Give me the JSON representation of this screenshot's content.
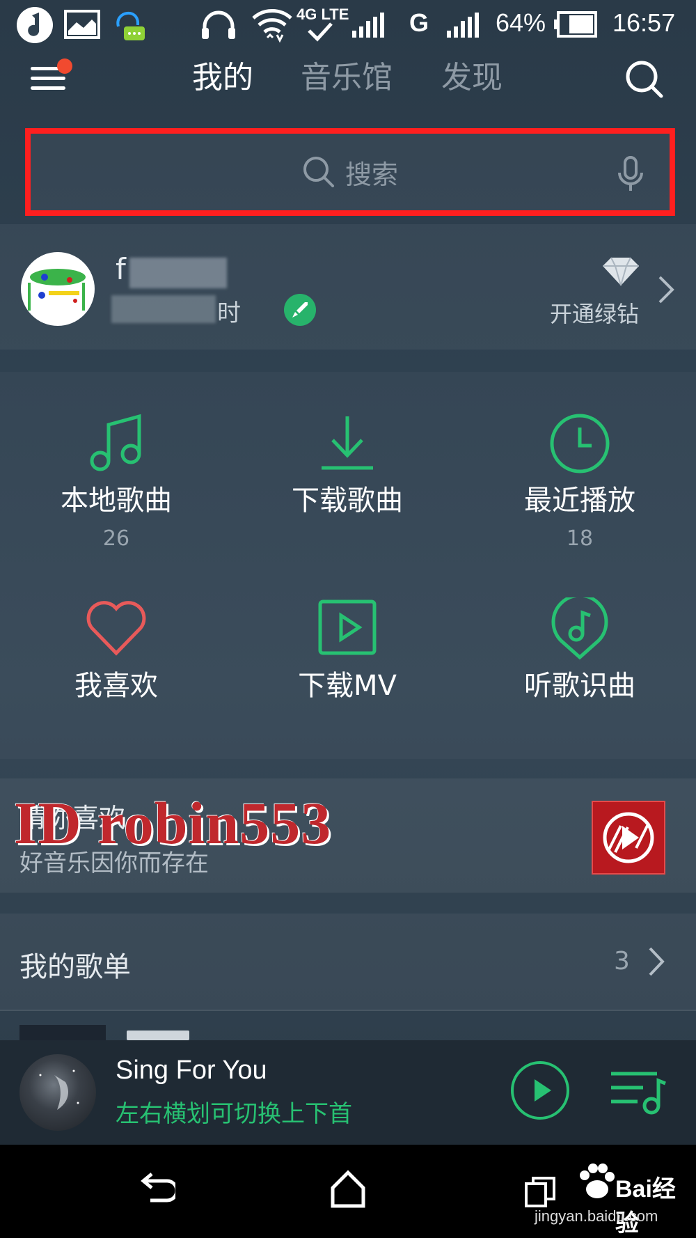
{
  "status_bar": {
    "network_label": "4G LTE",
    "carrier_g": "G",
    "battery_percent": "64%",
    "time": "16:57"
  },
  "nav": {
    "tabs": [
      {
        "label": "我的",
        "active": true
      },
      {
        "label": "音乐馆",
        "active": false
      },
      {
        "label": "发现",
        "active": false
      }
    ]
  },
  "search": {
    "placeholder": "搜索"
  },
  "profile": {
    "username_visible": "f",
    "listen_time_suffix": "时",
    "vip_label": "开通绿钻"
  },
  "grid": [
    {
      "label": "本地歌曲",
      "count": "26",
      "icon": "music-note-icon"
    },
    {
      "label": "下载歌曲",
      "count": "",
      "icon": "download-icon"
    },
    {
      "label": "最近播放",
      "count": "18",
      "icon": "clock-icon"
    },
    {
      "label": "我喜欢",
      "count": "",
      "icon": "heart-icon"
    },
    {
      "label": "下载MV",
      "count": "",
      "icon": "video-play-icon"
    },
    {
      "label": "听歌识曲",
      "count": "",
      "icon": "music-recognize-icon"
    }
  ],
  "guess": {
    "title": "猜你喜欢",
    "subtitle": "好音乐因你而存在",
    "watermark": "ID robin553"
  },
  "playlists": {
    "title": "我的歌单",
    "count": "3"
  },
  "player": {
    "song": "Sing For You",
    "hint": "左右横划可切换上下首"
  },
  "watermark_site": {
    "brand": "Bai经验",
    "url": "jingyan.baidu.com"
  },
  "colors": {
    "accent_green": "#27c172",
    "heart_red": "#e85a5a",
    "highlight_red": "#ff1f1f",
    "notification_dot": "#f14a2f"
  }
}
